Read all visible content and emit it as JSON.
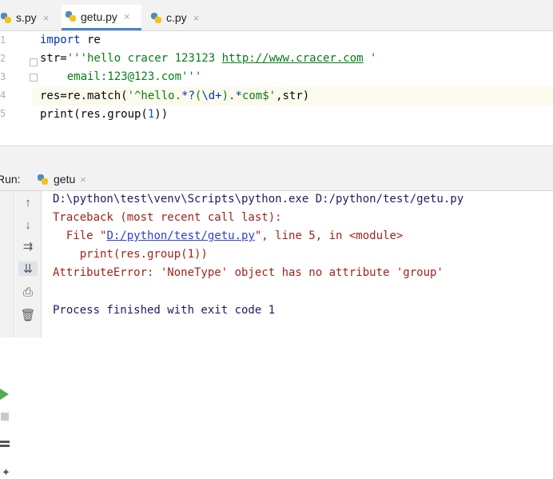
{
  "tabs": [
    {
      "label": "s.py",
      "close": "×",
      "active": false
    },
    {
      "label": "getu.py",
      "close": "×",
      "active": true
    },
    {
      "label": "c.py",
      "close": "×",
      "active": false
    }
  ],
  "editor": {
    "line_numbers": [
      "1",
      "2",
      "3",
      "4",
      "5"
    ],
    "lines": [
      [
        "import",
        " re"
      ],
      [
        "str=",
        "'''hello cracer 123123 ",
        "http://www.cracer.com",
        " '"
      ],
      [
        "    email:123@123.com'''"
      ],
      [
        "res=re.match(",
        "'^hello.",
        "*?",
        "(",
        "\\d+",
        ")",
        ".",
        "*",
        "com$",
        "'",
        ",str)"
      ],
      [
        "print(res.group(",
        "1",
        "))"
      ]
    ]
  },
  "run_panel": {
    "label": "Run:",
    "tab_label": "getu",
    "tab_close": "×",
    "console": {
      "command": "D:\\python\\test\\venv\\Scripts\\python.exe D:/python/test/getu.py",
      "traceback_header": "Traceback (most recent call last):",
      "file_prefix": "  File \"",
      "file_link": "D:/python/test/getu.py",
      "file_suffix": "\", line 5, in <module>",
      "code_line": "    print(res.group(1))",
      "error": "AttributeError: 'NoneType' object has no attribute 'group'",
      "exit": "Process finished with exit code 1"
    }
  },
  "colors": {
    "accent": "#4a86c7",
    "keyword": "#0033b3",
    "string": "#067d17",
    "error": "#a1231c",
    "console_text": "#1c1c63"
  }
}
